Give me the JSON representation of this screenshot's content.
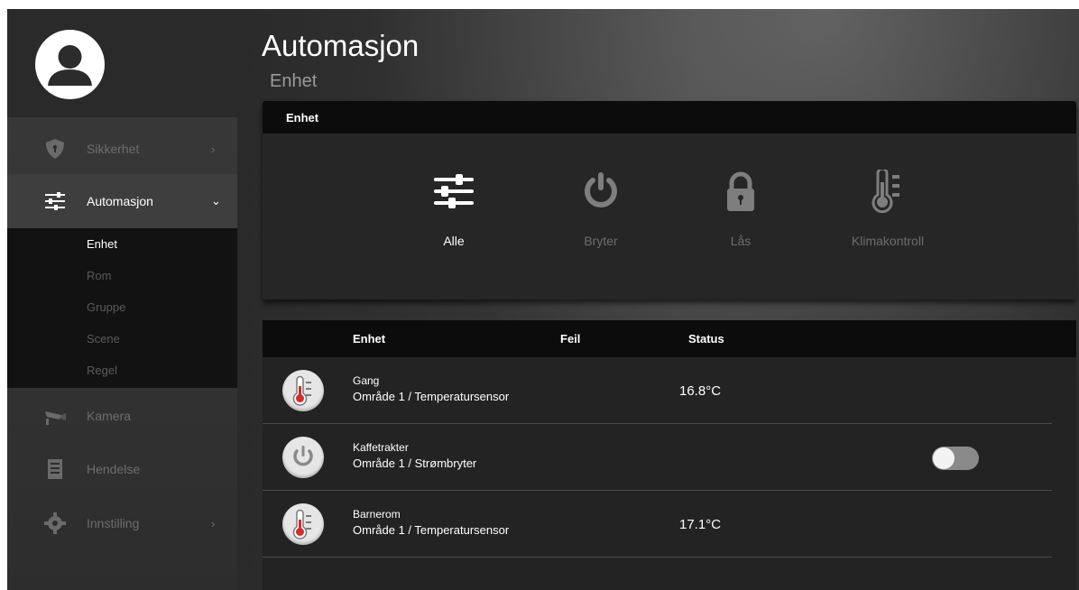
{
  "sidebar": {
    "items": [
      {
        "label": "Sikkerhet",
        "icon": "shield-icon",
        "chevron": "›"
      },
      {
        "label": "Automasjon",
        "icon": "sliders-icon",
        "chevron": "⌄"
      },
      {
        "label": "Kamera",
        "icon": "camera-icon"
      },
      {
        "label": "Hendelse",
        "icon": "document-icon"
      },
      {
        "label": "Innstilling",
        "icon": "gear-icon",
        "chevron": "›"
      }
    ],
    "subitems": [
      "Enhet",
      "Rom",
      "Gruppe",
      "Scene",
      "Regel"
    ]
  },
  "page": {
    "title": "Automasjon",
    "subtitle": "Enhet"
  },
  "filter_panel": {
    "header": "Enhet",
    "filters": [
      {
        "label": "Alle",
        "icon": "sliders-icon",
        "active": true
      },
      {
        "label": "Bryter",
        "icon": "power-icon"
      },
      {
        "label": "Lås",
        "icon": "lock-icon"
      },
      {
        "label": "Klimakontroll",
        "icon": "thermometer-icon"
      }
    ]
  },
  "device_table": {
    "columns": [
      "Enhet",
      "Feil",
      "Status"
    ],
    "rows": [
      {
        "name": "Gang",
        "location": "Område 1 / Temperatursensor",
        "status": "16.8°C",
        "icon": "thermometer-icon"
      },
      {
        "name": "Kaffetrakter",
        "location": "Område 1 / Strømbryter",
        "status": "",
        "icon": "power-icon",
        "toggle": "off"
      },
      {
        "name": "Barnerom",
        "location": "Område 1 / Temperatursensor",
        "status": "17.1°C",
        "icon": "thermometer-icon"
      }
    ]
  },
  "colors": {
    "thermometer_red": "#d62b2b",
    "icon_grey": "#8a8a8a",
    "active_white": "#ffffff"
  }
}
